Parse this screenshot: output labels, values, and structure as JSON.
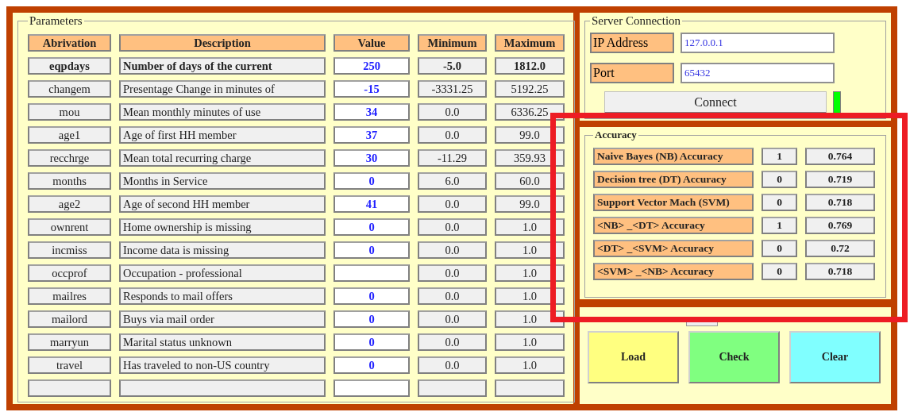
{
  "parameters": {
    "title": "Parameters",
    "columns": [
      "Abrivation",
      "Description",
      "Value",
      "Minimum",
      "Maximum"
    ],
    "rows": [
      {
        "abbreviation": "eqpdays",
        "description": "Number of days of the current",
        "value": "250",
        "minimum": "-5.0",
        "maximum": "1812.0",
        "bold": true
      },
      {
        "abbreviation": "changem",
        "description": "Presentage  Change in minutes of",
        "value": "-15",
        "minimum": "-3331.25",
        "maximum": "5192.25",
        "bold": false
      },
      {
        "abbreviation": "mou",
        "description": "Mean monthly minutes of use",
        "value": "34",
        "minimum": "0.0",
        "maximum": "6336.25",
        "bold": false
      },
      {
        "abbreviation": "age1",
        "description": "Age of first HH member",
        "value": "37",
        "minimum": "0.0",
        "maximum": "99.0",
        "bold": false
      },
      {
        "abbreviation": "recchrge",
        "description": "Mean total recurring charge",
        "value": "30",
        "minimum": "-11.29",
        "maximum": "359.93",
        "bold": false
      },
      {
        "abbreviation": "months",
        "description": "Months in Service",
        "value": "0",
        "minimum": "6.0",
        "maximum": "60.0",
        "bold": false
      },
      {
        "abbreviation": "age2",
        "description": "Age of second HH member",
        "value": "41",
        "minimum": "0.0",
        "maximum": "99.0",
        "bold": false
      },
      {
        "abbreviation": "ownrent",
        "description": "Home ownership is missing",
        "value": "0",
        "minimum": "0.0",
        "maximum": "1.0",
        "bold": false
      },
      {
        "abbreviation": "incmiss",
        "description": "Income data is missing",
        "value": "0",
        "minimum": "0.0",
        "maximum": "1.0",
        "bold": false
      },
      {
        "abbreviation": "occprof",
        "description": "Occupation - professional",
        "minimum": "0.0",
        "maximum": "1.0",
        "bold": false
      },
      {
        "abbreviation": "mailres",
        "description": "Responds to mail offers",
        "value": "0",
        "minimum": "0.0",
        "maximum": "1.0",
        "bold": false
      },
      {
        "abbreviation": "mailord",
        "description": "Buys via mail order",
        "value": "0",
        "minimum": "0.0",
        "maximum": "1.0",
        "bold": false
      },
      {
        "abbreviation": "marryun",
        "description": "Marital status unknown",
        "value": "0",
        "minimum": "0.0",
        "maximum": "1.0",
        "bold": false
      },
      {
        "abbreviation": "travel",
        "description": "Has traveled to non-US country",
        "value": "0",
        "minimum": "0.0",
        "maximum": "1.0",
        "bold": false
      },
      {}
    ]
  },
  "server_connection": {
    "title": "Server Connection",
    "fields": [
      {
        "label": "IP Address",
        "value": "127.0.0.1"
      },
      {
        "label": "Port",
        "value": "65432"
      }
    ],
    "connect_button": "Connect",
    "connected": true
  },
  "accuracy": {
    "title": "Accuracy",
    "rows": [
      {
        "label": "Naive Bayes (NB)  Accuracy",
        "prediction": "1",
        "score": "0.764"
      },
      {
        "label": "Decision tree (DT) Accuracy",
        "prediction": "0",
        "score": "0.719"
      },
      {
        "label": "Support Vector Mach (SVM)",
        "prediction": "0",
        "score": "0.718"
      },
      {
        "label": "<NB> _<DT>  Accuracy",
        "prediction": "1",
        "score": "0.769"
      },
      {
        "label": "<DT> _<SVM> Accuracy",
        "prediction": "0",
        "score": "0.72"
      },
      {
        "label": "<SVM> _<NB> Accuracy",
        "prediction": "0",
        "score": "0.718"
      }
    ]
  },
  "actions": [
    {
      "label": "Load",
      "color": "#ffff80"
    },
    {
      "label": "Check",
      "color": "#80ff80"
    },
    {
      "label": "Clear",
      "color": "#80ffff"
    }
  ],
  "highlight": {
    "shown": true
  }
}
